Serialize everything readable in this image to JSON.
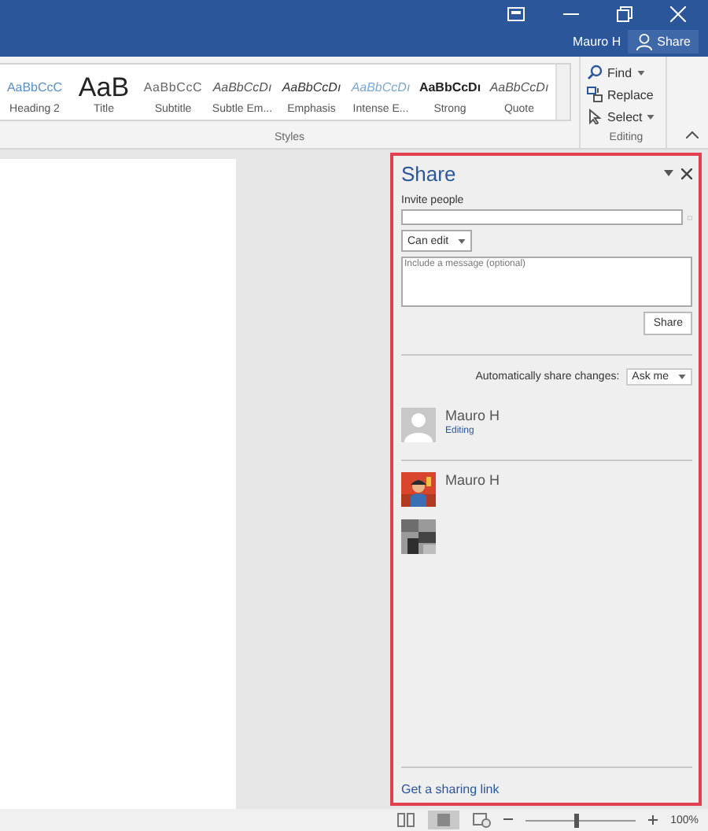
{
  "title_bar": {
    "user": "Mauro H",
    "share_button": "Share"
  },
  "styles_gallery": [
    {
      "sample": "AaBbCcC",
      "label": "Heading 2",
      "kind": "heading2"
    },
    {
      "sample": "AaB",
      "label": "Title",
      "kind": "title"
    },
    {
      "sample": "AaBbCcC",
      "label": "Subtitle",
      "kind": "subtitle"
    },
    {
      "sample": "AaBbCcDı",
      "label": "Subtle Em...",
      "kind": "subtle"
    },
    {
      "sample": "AaBbCcDı",
      "label": "Emphasis",
      "kind": "emphasis"
    },
    {
      "sample": "AaBbCcDı",
      "label": "Intense E...",
      "kind": "intense"
    },
    {
      "sample": "AaBbCcDı",
      "label": "Strong",
      "kind": "strong"
    },
    {
      "sample": "AaBbCcDı",
      "label": "Quote",
      "kind": "quote"
    }
  ],
  "styles_group_label": "Styles",
  "editing": {
    "commands": [
      {
        "label": "Find",
        "kind": "find",
        "dropdown": true
      },
      {
        "label": "Replace",
        "kind": "replace",
        "dropdown": false
      },
      {
        "label": "Select",
        "kind": "select",
        "dropdown": true
      }
    ],
    "group_label": "Editing"
  },
  "share_pane": {
    "title": "Share",
    "invite_label": "Invite people",
    "permission": "Can edit",
    "message_placeholder": "Include a message (optional)",
    "share_button": "Share",
    "auto_share_label": "Automatically share changes:",
    "auto_share_value": "Ask me",
    "people": [
      {
        "kind": "silhouette",
        "name": "Mauro H",
        "role": "Editing"
      },
      {
        "kind": "picture",
        "name": "Mauro H"
      },
      {
        "kind": "blurred"
      }
    ],
    "sharing_link": "Get a sharing link"
  },
  "status_bar": {
    "zoom": {
      "level": 0.45
    },
    "zoom_label": "100%"
  }
}
